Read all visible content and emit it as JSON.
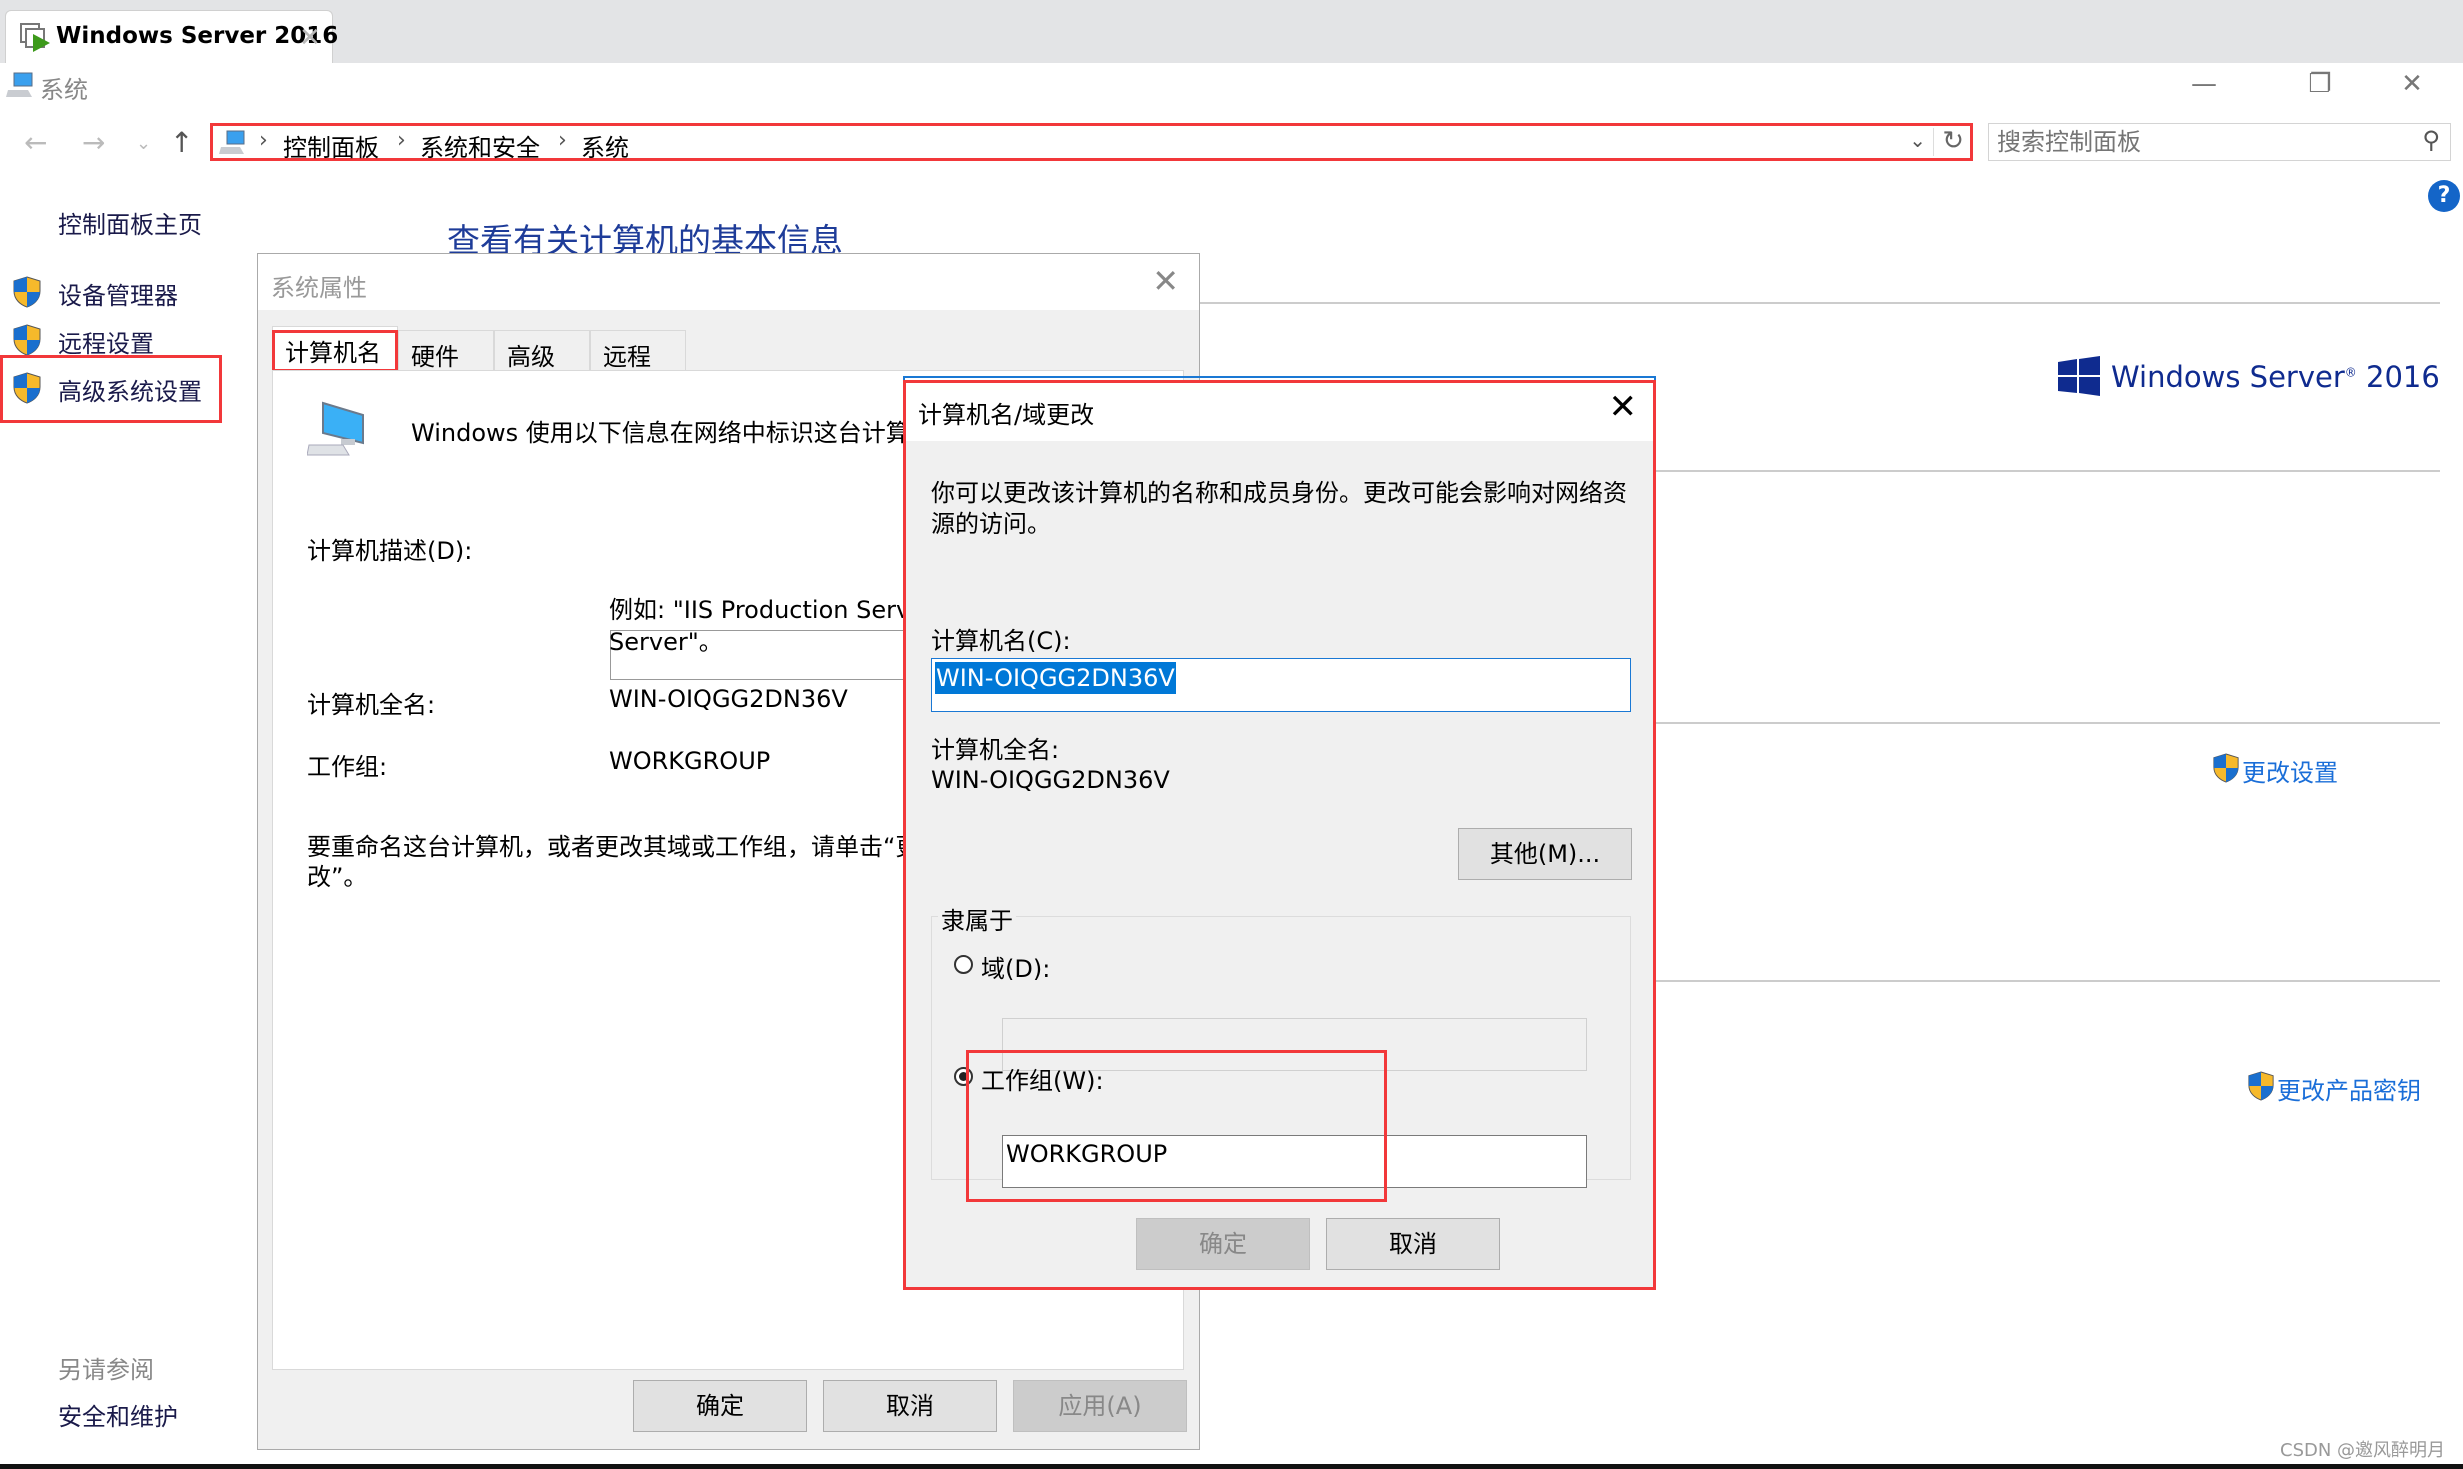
{
  "browser_tab": {
    "title": "Windows Server 2016",
    "icon": "vm-console-icon",
    "close_icon": "close-icon"
  },
  "window": {
    "title": "系统",
    "icon": "computer-icon",
    "controls": {
      "minimize": "minimize-icon",
      "restore": "restore-icon",
      "close": "close-icon"
    }
  },
  "nav": {
    "back": "back-arrow-icon",
    "forward": "forward-arrow-icon",
    "recent": "chevron-down-icon",
    "up": "up-arrow-icon",
    "breadcrumb": [
      "控制面板",
      "系统和安全",
      "系统"
    ],
    "refresh_icon": "refresh-icon",
    "search_placeholder": "搜索控制面板"
  },
  "sidebar": {
    "home": "控制面板主页",
    "items": [
      {
        "label": "设备管理器",
        "icon": "uac-shield-icon"
      },
      {
        "label": "远程设置",
        "icon": "uac-shield-icon"
      },
      {
        "label": "高级系统设置",
        "icon": "uac-shield-icon",
        "highlighted": true
      }
    ],
    "see_also_title": "另请参阅",
    "see_also": [
      "安全和维护"
    ]
  },
  "main": {
    "heading": "查看有关计算机的基本信息",
    "logo_text": "Windows Server",
    "logo_reg": "®",
    "logo_year": "2016",
    "change_settings": "更改设置",
    "change_product_key": "更改产品密钥"
  },
  "system_properties": {
    "title": "系统属性",
    "tabs": [
      "计算机名",
      "硬件",
      "高级",
      "远程"
    ],
    "active_tab": "计算机名",
    "intro": "Windows 使用以下信息在网络中标识这台计算",
    "desc_label": "计算机描述(D):",
    "desc_value": "",
    "example_line1": "例如: \"IIS Production Server",
    "example_line2": "Server\"。",
    "full_name_label": "计算机全名:",
    "full_name": "WIN-OIQGG2DN36V",
    "workgroup_label": "工作组:",
    "workgroup": "WORKGROUP",
    "rename_hint_line1": "要重命名这台计算机，或者更改其域或工作组，请单击“更",
    "rename_hint_line2": "改”。",
    "buttons": {
      "ok": "确定",
      "cancel": "取消",
      "apply": "应用(A)"
    }
  },
  "change_dialog": {
    "title": "计算机名/域更改",
    "description_line1": "你可以更改该计算机的名称和成员身份。更改可能会影响对网络资",
    "description_line2": "源的访问。",
    "computer_name_label": "计算机名(C):",
    "computer_name_value": "WIN-OIQGG2DN36V",
    "full_name_label": "计算机全名:",
    "full_name": "WIN-OIQGG2DN36V",
    "more_button": "其他(M)...",
    "member_of_label": "隶属于",
    "domain_label": "域(D):",
    "domain_value": "",
    "domain_selected": false,
    "workgroup_label": "工作组(W):",
    "workgroup_value": "WORKGROUP",
    "workgroup_selected": true,
    "buttons": {
      "ok": "确定",
      "cancel": "取消"
    }
  },
  "colors": {
    "annotation_red": "#f2383a",
    "heading_blue": "#1e3c99",
    "link_blue": "#1a6ed8",
    "selection_blue": "#0078d7"
  },
  "watermark": "CSDN @邀风醉明月"
}
